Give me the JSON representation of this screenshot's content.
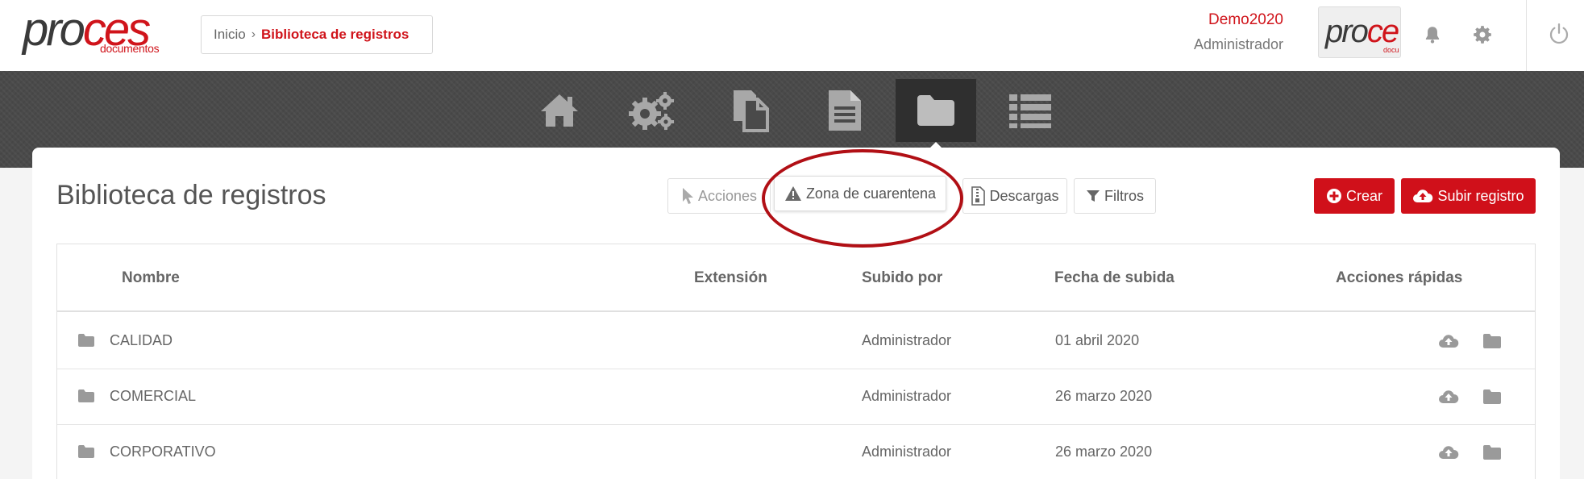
{
  "brand": {
    "logo_part1": "pro",
    "logo_part2": "ces",
    "logo_sub": "documentos",
    "mini_part1": "pro",
    "mini_part2": "ce",
    "mini_sub": "docu"
  },
  "breadcrumb": {
    "home": "Inicio",
    "separator": "›",
    "current": "Biblioteca de registros"
  },
  "user": {
    "name": "Demo2020",
    "role": "Administrador"
  },
  "header_icons": [
    "bell-icon",
    "gear-icon",
    "power-icon"
  ],
  "nav": {
    "items": [
      {
        "name": "home-icon"
      },
      {
        "name": "gears-icon"
      },
      {
        "name": "documents-copy-icon"
      },
      {
        "name": "document-text-icon"
      },
      {
        "name": "folder-icon",
        "active": true
      },
      {
        "name": "list-icon"
      }
    ]
  },
  "page": {
    "title": "Biblioteca de registros"
  },
  "toolbar": {
    "acciones": "Acciones",
    "cuarentena": "Zona de cuarentena",
    "descargas": "Descargas",
    "filtros": "Filtros",
    "crear": "Crear",
    "subir": "Subir registro"
  },
  "table": {
    "headers": {
      "nombre": "Nombre",
      "extension": "Extensión",
      "subido_por": "Subido por",
      "fecha": "Fecha de subida",
      "acciones": "Acciones rápidas"
    },
    "rows": [
      {
        "nombre": "CALIDAD",
        "extension": "",
        "subido_por": "Administrador",
        "fecha": "01 abril 2020"
      },
      {
        "nombre": "COMERCIAL",
        "extension": "",
        "subido_por": "Administrador",
        "fecha": "26 marzo 2020"
      },
      {
        "nombre": "CORPORATIVO",
        "extension": "",
        "subido_por": "Administrador",
        "fecha": "26 marzo 2020"
      }
    ]
  },
  "colors": {
    "brand_red": "#d0141b",
    "nav_bg": "#4a4a4a",
    "icon_gray": "#9a9a9a",
    "annotation": "#b10f15"
  }
}
